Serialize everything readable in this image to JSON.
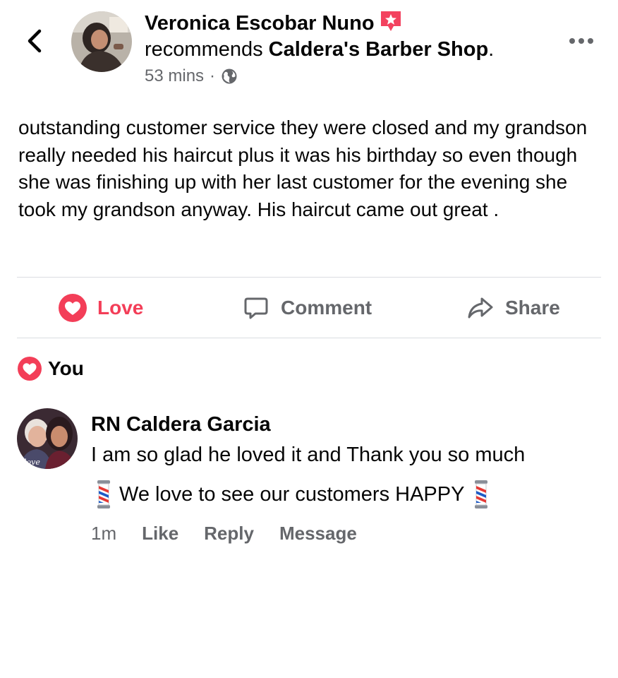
{
  "post": {
    "author": "Veronica Escobar Nuno",
    "recommends_prefix": "recommends ",
    "page_name": "Caldera's Barber Shop",
    "page_suffix": ".",
    "time": "53 mins",
    "dot": "·",
    "privacy_icon": "globe-icon",
    "badge_icon": "recommendation-star-badge",
    "text": "outstanding customer service they were closed and my grandson really needed his haircut plus it was his birthday so even though she was finishing up with her last customer for the evening she took my grandson anyway. His haircut came out great ."
  },
  "actions": {
    "love_label": "Love",
    "comment_label": "Comment",
    "share_label": "Share"
  },
  "reactions": {
    "summary": "You",
    "icon": "love-reaction-icon"
  },
  "comment": {
    "author": "RN Caldera Garcia",
    "line1": "I am so glad he loved it and Thank you so much",
    "line2": "We love to see our customers HAPPY",
    "line2_emoji": "barber-pole-emoji",
    "time": "1m",
    "like_label": "Like",
    "reply_label": "Reply",
    "message_label": "Message",
    "avatar_text": "love"
  },
  "colors": {
    "love_red": "#f33e58",
    "secondary_text": "#65676b",
    "divider": "#dadde1",
    "primary_text": "#050505"
  }
}
